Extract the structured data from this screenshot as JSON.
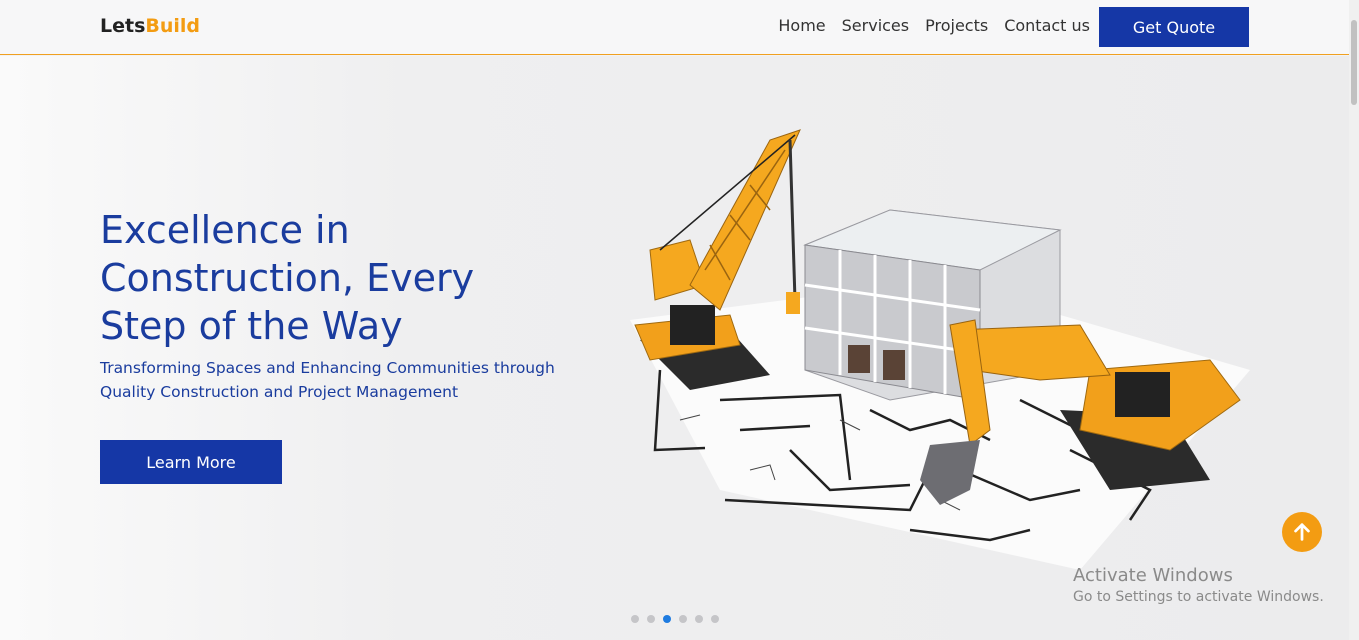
{
  "header": {
    "logo_part1": "Lets",
    "logo_part2": "Build",
    "nav": [
      "Home",
      "Services",
      "Projects",
      "Contact us"
    ],
    "cta_label": "Get Quote"
  },
  "hero": {
    "title": "Excellence in Construction, Every Step of the Way",
    "subtitle": "Transforming Spaces and Enhancing Communities through Quality Construction and Project Management",
    "button_label": "Learn More"
  },
  "carousel": {
    "slide_count": 6,
    "active_index": 2
  },
  "watermark": {
    "line1": "Activate Windows",
    "line2": "Go to Settings to activate Windows."
  },
  "colors": {
    "brand_blue": "#1537a6",
    "accent_orange": "#f39c12",
    "dot_active": "#1e7be0"
  },
  "icons": {
    "back_to_top": "arrow-up-icon"
  }
}
